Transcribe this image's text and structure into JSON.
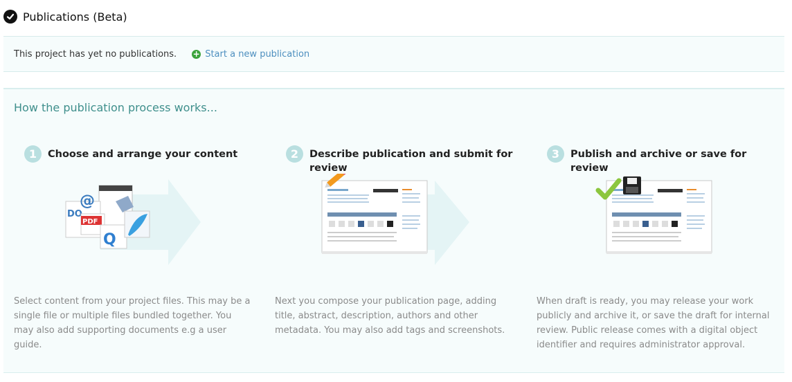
{
  "header": {
    "title": "Publications (Beta)"
  },
  "notice": {
    "text": "This project has yet no publications.",
    "start_link": "Start a new publication"
  },
  "process": {
    "title": "How the publication process works...",
    "steps": [
      {
        "number": "1",
        "title": "Choose and arrange your content",
        "description": "Select content from your project files. This may be a single file or multiple files bundled together. You may also add supporting documents e.g a user guide."
      },
      {
        "number": "2",
        "title": "Describe publication and submit for review",
        "description": "Next you compose your publication page, adding title, abstract, description, authors and other metadata. You may also add tags and screenshots."
      },
      {
        "number": "3",
        "title": "Publish and archive or save for review",
        "description": "When draft is ready, you may release your work publicly and archive it, or save the draft for internal review. Public release comes with a digital object identifier and requires administrator approval."
      }
    ]
  },
  "colors": {
    "accent": "#3f8f8c",
    "link": "#4d8fbf",
    "step_badge": "#b9dfe0",
    "panel_bg": "#f6fcfc"
  }
}
